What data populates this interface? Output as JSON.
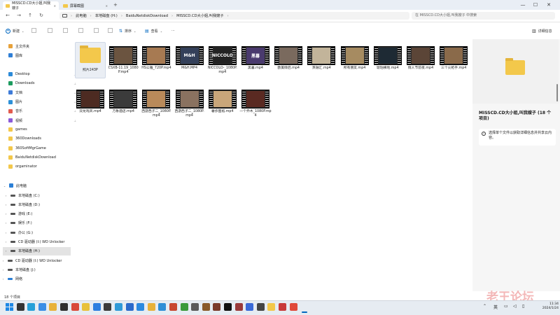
{
  "tabs": [
    {
      "label": "MISSCD.CD大小姐,叫我嫂子"
    },
    {
      "label": "屏幕截图"
    }
  ],
  "window": {
    "minimize": "—",
    "maximize": "☐",
    "close": "✕",
    "new_tab": "+"
  },
  "breadcrumb": [
    "此电脑",
    "本地磁盘 (H:)",
    "BaiduNetdiskDownload",
    "MISSCD.CD大小姐,叫我嫂子"
  ],
  "search_placeholder": "在 MISSCD.CD大小姐,叫我嫂子 中搜索",
  "toolbar": {
    "new": "新建",
    "sort": "排序",
    "view": "查看",
    "more": "···",
    "details": "详细信息"
  },
  "sidebar": {
    "quick": [
      {
        "label": "主文件夹",
        "color": "#e7a23b"
      },
      {
        "label": "图库",
        "color": "#2f7fd6"
      }
    ],
    "pinned": [
      {
        "label": "Desktop",
        "color": "#2b8ad8"
      },
      {
        "label": "Downloads",
        "color": "#1c9b5f"
      },
      {
        "label": "文档",
        "color": "#3e7bd8"
      },
      {
        "label": "图片",
        "color": "#2c90d8"
      },
      {
        "label": "音乐",
        "color": "#e25b4e"
      },
      {
        "label": "视频",
        "color": "#8b5ad8"
      },
      {
        "label": "games",
        "color": "#f3c84b"
      },
      {
        "label": "360Downloads",
        "color": "#f3c84b"
      },
      {
        "label": "360SoftMgrGame",
        "color": "#f3c84b"
      },
      {
        "label": "BaiduNetdiskDownload",
        "color": "#f3c84b"
      },
      {
        "label": "orgaminator",
        "color": "#f3c84b"
      }
    ],
    "this_pc": "此电脑",
    "drives": [
      "本地磁盘 (C:)",
      "本地磁盘 (D:)",
      "游戏 (E:)",
      "娱乐 (F:)",
      "办公 (G:)",
      "CD 驱动器 (I:) WD Unlocker",
      "本地磁盘 (H:)"
    ],
    "root": [
      "CD 驱动器 (I:) WD Unlocker",
      "本地磁盘 (J:)",
      "网络"
    ]
  },
  "files": [
    {
      "name": "照片243P",
      "type": "folder"
    },
    {
      "name": "CSXB-11.19_1080P.mp4",
      "c": "#6b5440"
    },
    {
      "name": "HS公雅_720P.mp4",
      "c": "#a77a52"
    },
    {
      "name": "M&H.MP4",
      "c": "#34405a",
      "t": "M&H"
    },
    {
      "name": "NICCOLO-_1080P.mp4",
      "c": "#232323",
      "t": "NICCOLO"
    },
    {
      "name": "黑暮.mp4",
      "c": "#4a3a6e",
      "t": "黑暮"
    },
    {
      "name": "欧美情侣.mp4",
      "c": "#7a6a5e"
    },
    {
      "name": "蒸融汇.mp4",
      "c": "#c2b49a"
    },
    {
      "name": "所有朋友.mp4",
      "c": "#a68b61"
    },
    {
      "name": "琥珀横地.mp4",
      "c": "#1e2a34"
    },
    {
      "name": "情人节前夜.mp4",
      "c": "#5b4537"
    },
    {
      "name": "三个火枪手.mp4",
      "c": "#8a6a4a"
    },
    {
      "name": "双龙戏凤.mp4",
      "c": "#4d2b22"
    },
    {
      "name": "万象酒店.mp4",
      "c": "#3b3b3b"
    },
    {
      "name": "西游西子二_1080P.mp4",
      "c": "#b98a5a"
    },
    {
      "name": "西游西子二_1080P.mp4",
      "c": "#8a7260"
    },
    {
      "name": "奢侈图纸.mp4",
      "c": "#c9a67a"
    },
    {
      "name": "一个乔木_1080P.mp4",
      "c": "#5a2a22"
    }
  ],
  "details": {
    "title": "MISSCD.CD大小姐,叫我嫂子 (18 个项目)",
    "info": "选择单个文件以获取详细信息并共享云内容。"
  },
  "status": "18 个项目",
  "taskbar": {
    "lang": "英",
    "time": "11:34",
    "date": "2024/1/24"
  },
  "taskbar_icons": [
    "#1f6fd1",
    "#333",
    "#26a0d8",
    "#3a8ee6",
    "#e8b23a",
    "#2f2f2f",
    "#d94a3a",
    "#e8c13a",
    "#2d7fe0",
    "#3b3b3b",
    "#2f9ad8",
    "#2a6acb",
    "#2a8ae0",
    "#e8b23a",
    "#2f8fd6",
    "#c8462f",
    "#3a9a3a",
    "#5a5a5a",
    "#8a5a2a",
    "#7a3a2a",
    "#111",
    "#9a3a3a",
    "#3a6ad8",
    "#444",
    "#f3c84b",
    "#c83a3a",
    "#e04a3a"
  ],
  "watermark": "老王论坛"
}
